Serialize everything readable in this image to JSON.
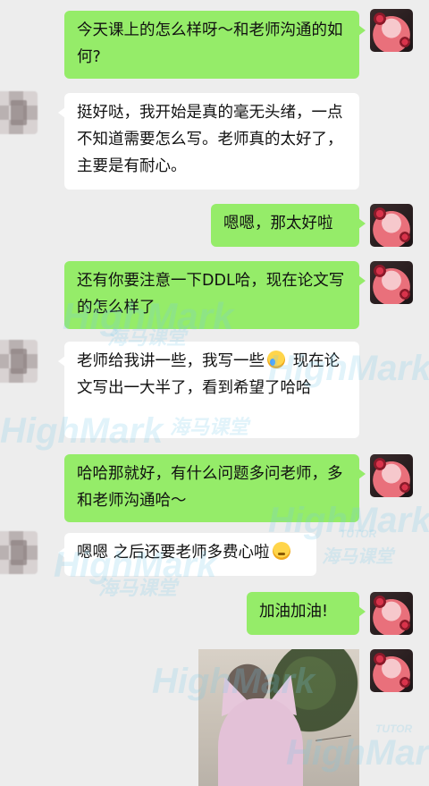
{
  "messages": [
    {
      "id": "m1",
      "side": "out",
      "text": "今天课上的怎么样呀～和老师沟通的如何?"
    },
    {
      "id": "m2",
      "side": "in",
      "text": "挺好哒，我开始是真的毫无头绪，一点不知道需要怎么写。老师真的太好了，主要是有耐心。"
    },
    {
      "id": "m3",
      "side": "out",
      "text": "嗯嗯，那太好啦"
    },
    {
      "id": "m4",
      "side": "out",
      "text": "还有你要注意一下DDL哈，现在论文写的怎么样了"
    },
    {
      "id": "m5",
      "side": "in",
      "text_before": "老师给我讲一些，我写一些",
      "emoji": "crying-laughing-emoji",
      "text_after": " 现在论文写出一大半了，看到希望了哈哈"
    },
    {
      "id": "m6",
      "side": "out",
      "text": "哈哈那就好，有什么问题多问老师，多和老师沟通哈～"
    },
    {
      "id": "m7",
      "side": "in",
      "text_before": "嗯嗯 之后还要老师多费心啦",
      "emoji": "thinking-face-emoji",
      "text_after": ""
    },
    {
      "id": "m8",
      "side": "out",
      "text": "加油加油!"
    },
    {
      "id": "m9",
      "side": "out",
      "type": "image",
      "image_subject": "pink stuffed cat toy with plants"
    }
  ],
  "watermark": {
    "brand": "HighMark",
    "sub": "海马课堂",
    "tag": "TUTOR"
  },
  "colors": {
    "background": "#ededed",
    "outgoing_bubble": "#95ec69",
    "incoming_bubble": "#ffffff"
  }
}
